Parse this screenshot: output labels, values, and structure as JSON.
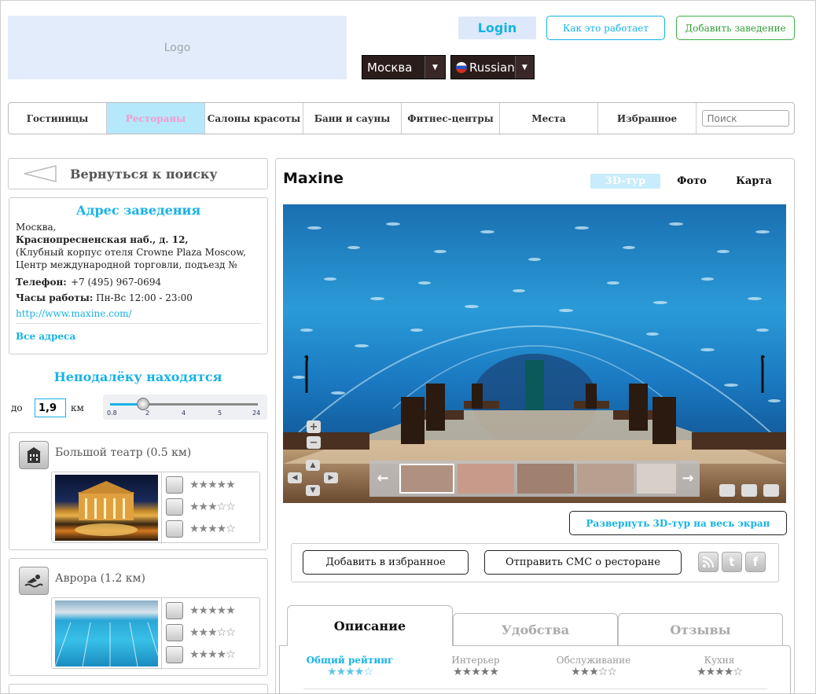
{
  "header": {
    "logo_text": "Logo",
    "login_label": "Login",
    "how_it_works_label": "Как это работает",
    "add_place_label": "Добавить заведение",
    "city_select": "Москва",
    "language_select": "Russian"
  },
  "nav": {
    "items": [
      {
        "label": "Гостиницы"
      },
      {
        "label": "Рестораны"
      },
      {
        "label": "Салоны красоты"
      },
      {
        "label": "Бани и сауны"
      },
      {
        "label": "Фитнес-центры"
      },
      {
        "label": "Места"
      },
      {
        "label": "Избранное"
      }
    ],
    "active_index": 1,
    "search_placeholder": "Поиск"
  },
  "sidebar": {
    "back_label": "Вернуться к поиску",
    "address": {
      "title": "Адрес заведения",
      "city": "Москва,",
      "street": "Краснопресненская наб., д. 12,",
      "details": "(Клубный корпус отеля Crowne Plaza Moscow, Центр международной торговли, подъезд №",
      "phone_label": "Телефон:",
      "phone": "+7 (495) 967-0694",
      "hours_label": "Часы работы:",
      "hours": "Пн-Вс 12:00 - 23:00",
      "website": "http://www.maxine.com/",
      "all_addresses": "Все адреса"
    },
    "nearby": {
      "title": "Неподалёку находятся",
      "prefix": "до",
      "distance_value": "1,9",
      "unit": "км",
      "slider_ticks": [
        "0.8",
        "2",
        "4",
        "5",
        "24"
      ],
      "slider_value": 1.9,
      "places": [
        {
          "name": "Большой театр (0.5 км)",
          "icon": "building-icon",
          "ratings": [
            "★★★★★",
            "★★★☆☆",
            "★★★★☆"
          ]
        },
        {
          "name": "Аврора (1.2 км)",
          "icon": "swimmer-icon",
          "ratings": [
            "★★★★★",
            "★★★☆☆",
            "★★★★☆"
          ]
        }
      ]
    }
  },
  "main": {
    "title": "Maxine",
    "view_tabs": [
      {
        "label": "3D-тур",
        "active": true
      },
      {
        "label": "Фото",
        "active": false
      },
      {
        "label": "Карта",
        "active": false
      }
    ],
    "expand_label": "Развернуть 3D-тур на весь экран",
    "add_favorite_label": "Добавить в избранное",
    "send_sms_label": "Отправить СМС о ресторане",
    "social": [
      "rss-icon",
      "twitter-icon",
      "facebook-icon"
    ],
    "tabs": [
      {
        "label": "Описание",
        "active": true
      },
      {
        "label": "Удобства",
        "active": false
      },
      {
        "label": "Отзывы",
        "active": false
      }
    ],
    "ratings": [
      {
        "label": "Общий рейтинг",
        "stars": "★★★★☆"
      },
      {
        "label": "Интерьер",
        "stars": "★★★★★"
      },
      {
        "label": "Обслуживание",
        "stars": "★★★☆☆"
      },
      {
        "label": "Кухня",
        "stars": "★★★★☆"
      }
    ]
  },
  "colors": {
    "accent": "#17b2e6",
    "green": "#3cb043",
    "active_nav": "#b5e8fb",
    "active_nav_text": "#f49ad0"
  }
}
